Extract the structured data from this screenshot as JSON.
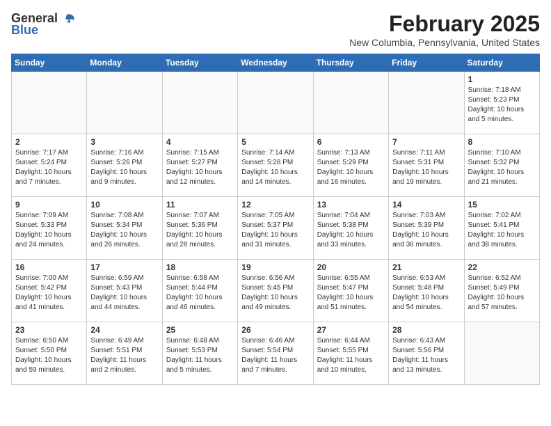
{
  "logo": {
    "general": "General",
    "blue": "Blue"
  },
  "title": "February 2025",
  "subtitle": "New Columbia, Pennsylvania, United States",
  "days_of_week": [
    "Sunday",
    "Monday",
    "Tuesday",
    "Wednesday",
    "Thursday",
    "Friday",
    "Saturday"
  ],
  "weeks": [
    [
      {
        "day": "",
        "detail": ""
      },
      {
        "day": "",
        "detail": ""
      },
      {
        "day": "",
        "detail": ""
      },
      {
        "day": "",
        "detail": ""
      },
      {
        "day": "",
        "detail": ""
      },
      {
        "day": "",
        "detail": ""
      },
      {
        "day": "1",
        "detail": "Sunrise: 7:18 AM\nSunset: 5:23 PM\nDaylight: 10 hours\nand 5 minutes."
      }
    ],
    [
      {
        "day": "2",
        "detail": "Sunrise: 7:17 AM\nSunset: 5:24 PM\nDaylight: 10 hours\nand 7 minutes."
      },
      {
        "day": "3",
        "detail": "Sunrise: 7:16 AM\nSunset: 5:26 PM\nDaylight: 10 hours\nand 9 minutes."
      },
      {
        "day": "4",
        "detail": "Sunrise: 7:15 AM\nSunset: 5:27 PM\nDaylight: 10 hours\nand 12 minutes."
      },
      {
        "day": "5",
        "detail": "Sunrise: 7:14 AM\nSunset: 5:28 PM\nDaylight: 10 hours\nand 14 minutes."
      },
      {
        "day": "6",
        "detail": "Sunrise: 7:13 AM\nSunset: 5:29 PM\nDaylight: 10 hours\nand 16 minutes."
      },
      {
        "day": "7",
        "detail": "Sunrise: 7:11 AM\nSunset: 5:31 PM\nDaylight: 10 hours\nand 19 minutes."
      },
      {
        "day": "8",
        "detail": "Sunrise: 7:10 AM\nSunset: 5:32 PM\nDaylight: 10 hours\nand 21 minutes."
      }
    ],
    [
      {
        "day": "9",
        "detail": "Sunrise: 7:09 AM\nSunset: 5:33 PM\nDaylight: 10 hours\nand 24 minutes."
      },
      {
        "day": "10",
        "detail": "Sunrise: 7:08 AM\nSunset: 5:34 PM\nDaylight: 10 hours\nand 26 minutes."
      },
      {
        "day": "11",
        "detail": "Sunrise: 7:07 AM\nSunset: 5:36 PM\nDaylight: 10 hours\nand 28 minutes."
      },
      {
        "day": "12",
        "detail": "Sunrise: 7:05 AM\nSunset: 5:37 PM\nDaylight: 10 hours\nand 31 minutes."
      },
      {
        "day": "13",
        "detail": "Sunrise: 7:04 AM\nSunset: 5:38 PM\nDaylight: 10 hours\nand 33 minutes."
      },
      {
        "day": "14",
        "detail": "Sunrise: 7:03 AM\nSunset: 5:39 PM\nDaylight: 10 hours\nand 36 minutes."
      },
      {
        "day": "15",
        "detail": "Sunrise: 7:02 AM\nSunset: 5:41 PM\nDaylight: 10 hours\nand 38 minutes."
      }
    ],
    [
      {
        "day": "16",
        "detail": "Sunrise: 7:00 AM\nSunset: 5:42 PM\nDaylight: 10 hours\nand 41 minutes."
      },
      {
        "day": "17",
        "detail": "Sunrise: 6:59 AM\nSunset: 5:43 PM\nDaylight: 10 hours\nand 44 minutes."
      },
      {
        "day": "18",
        "detail": "Sunrise: 6:58 AM\nSunset: 5:44 PM\nDaylight: 10 hours\nand 46 minutes."
      },
      {
        "day": "19",
        "detail": "Sunrise: 6:56 AM\nSunset: 5:45 PM\nDaylight: 10 hours\nand 49 minutes."
      },
      {
        "day": "20",
        "detail": "Sunrise: 6:55 AM\nSunset: 5:47 PM\nDaylight: 10 hours\nand 51 minutes."
      },
      {
        "day": "21",
        "detail": "Sunrise: 6:53 AM\nSunset: 5:48 PM\nDaylight: 10 hours\nand 54 minutes."
      },
      {
        "day": "22",
        "detail": "Sunrise: 6:52 AM\nSunset: 5:49 PM\nDaylight: 10 hours\nand 57 minutes."
      }
    ],
    [
      {
        "day": "23",
        "detail": "Sunrise: 6:50 AM\nSunset: 5:50 PM\nDaylight: 10 hours\nand 59 minutes."
      },
      {
        "day": "24",
        "detail": "Sunrise: 6:49 AM\nSunset: 5:51 PM\nDaylight: 11 hours\nand 2 minutes."
      },
      {
        "day": "25",
        "detail": "Sunrise: 6:48 AM\nSunset: 5:53 PM\nDaylight: 11 hours\nand 5 minutes."
      },
      {
        "day": "26",
        "detail": "Sunrise: 6:46 AM\nSunset: 5:54 PM\nDaylight: 11 hours\nand 7 minutes."
      },
      {
        "day": "27",
        "detail": "Sunrise: 6:44 AM\nSunset: 5:55 PM\nDaylight: 11 hours\nand 10 minutes."
      },
      {
        "day": "28",
        "detail": "Sunrise: 6:43 AM\nSunset: 5:56 PM\nDaylight: 11 hours\nand 13 minutes."
      },
      {
        "day": "",
        "detail": ""
      }
    ]
  ]
}
